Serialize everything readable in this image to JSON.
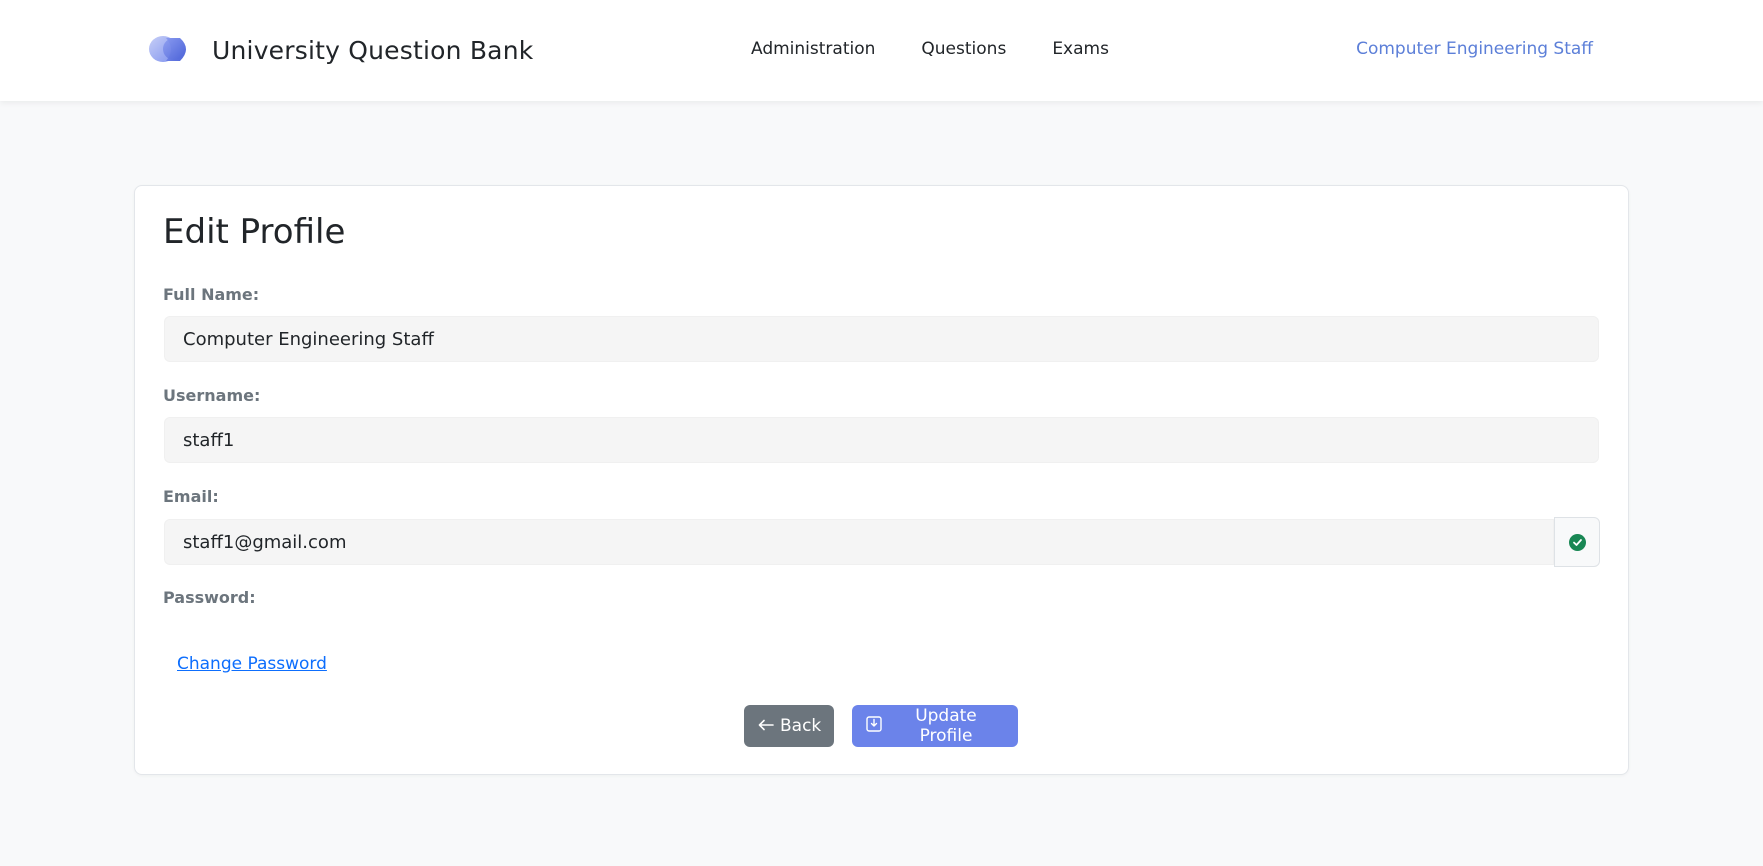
{
  "header": {
    "brand_title": "University Question Bank",
    "nav": [
      {
        "label": "Administration"
      },
      {
        "label": "Questions"
      },
      {
        "label": "Exams"
      }
    ],
    "user_name": "Computer Engineering Staff"
  },
  "form": {
    "title": "Edit Profile",
    "full_name_label": "Full Name:",
    "full_name_value": "Computer Engineering Staff",
    "username_label": "Username:",
    "username_value": "staff1",
    "email_label": "Email:",
    "email_value": "staff1@gmail.com",
    "password_label": "Password:",
    "change_password_link": "Change Password",
    "back_button": "Back",
    "update_button": "Update Profile"
  },
  "icons": {
    "back": "arrow-left-icon",
    "update": "save-icon",
    "email_status": "check-circle-icon",
    "logo": "logo-icon"
  },
  "colors": {
    "accent": "#6b83ea",
    "user_link": "#5c7fd8",
    "link": "#0d6efd",
    "back_button": "#6c757d",
    "valid": "#198754"
  }
}
